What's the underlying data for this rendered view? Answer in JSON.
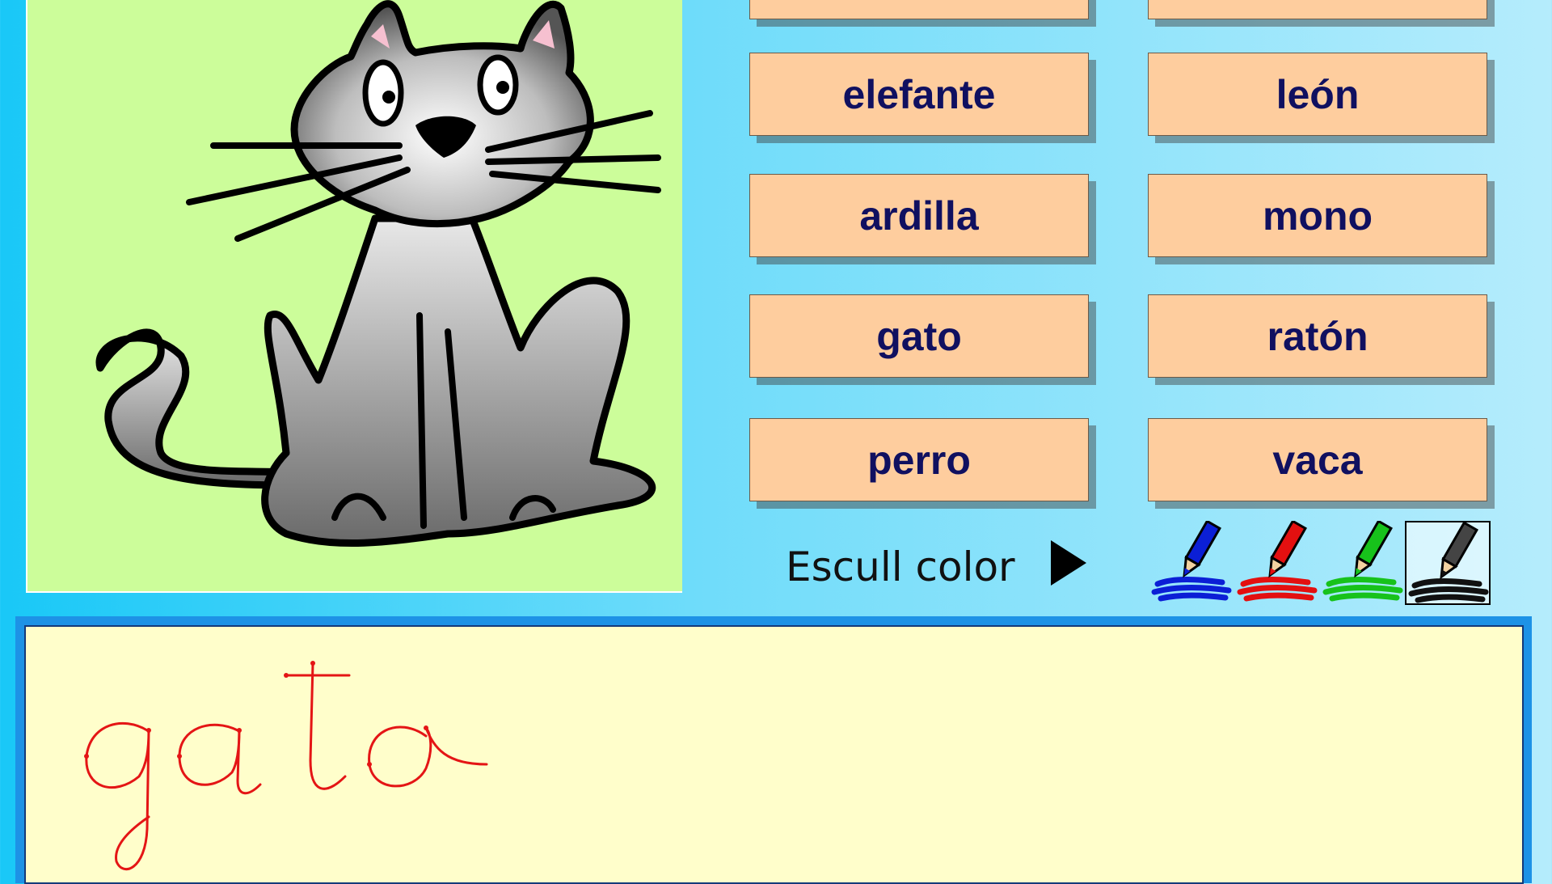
{
  "picture": {
    "subject": "cat",
    "icon": "cat-illustration"
  },
  "words": [
    {
      "label": ""
    },
    {
      "label": ""
    },
    {
      "label": "elefante"
    },
    {
      "label": "león"
    },
    {
      "label": "ardilla"
    },
    {
      "label": "mono"
    },
    {
      "label": "gato"
    },
    {
      "label": "ratón"
    },
    {
      "label": "perro"
    },
    {
      "label": "vaca"
    }
  ],
  "color_picker": {
    "label": "Escull color",
    "options": [
      {
        "name": "blue",
        "hex": "#0b1fd6"
      },
      {
        "name": "red",
        "hex": "#e31010"
      },
      {
        "name": "green",
        "hex": "#17c21b"
      },
      {
        "name": "black",
        "hex": "#111111"
      }
    ],
    "selected": "black"
  },
  "writing": {
    "text": "gato",
    "stroke_color": "#e41515",
    "background": "#fffecb"
  }
}
